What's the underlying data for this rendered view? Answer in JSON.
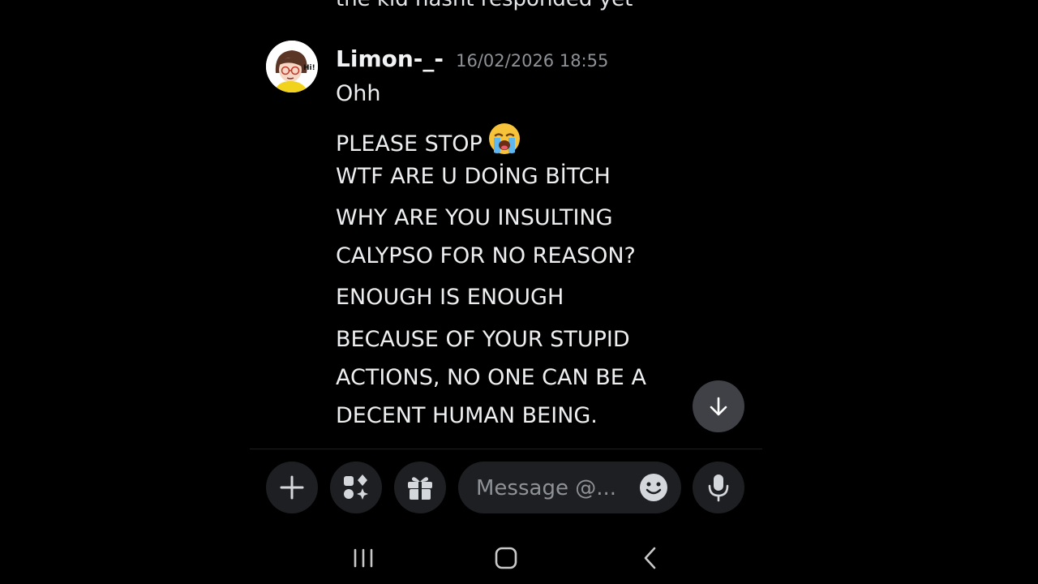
{
  "chat": {
    "previous_message_fragment": "the kid hasnt responded yet"
  },
  "message": {
    "author": "Limon-_-",
    "timestamp": "16/02/2026 18:55",
    "lines": [
      "Ohh",
      "PLEASE STOP",
      "WTF ARE U DOİNG BİTCH",
      "WHY ARE YOU INSULTING",
      "CALYPSO FOR NO REASON?",
      "ENOUGH IS ENOUGH",
      "BECAUSE OF YOUR STUPID",
      "ACTIONS, NO ONE CAN BE A",
      "DECENT HUMAN BEING."
    ],
    "emoji_after_line_2": "loudly-crying-face-emoji"
  },
  "composer": {
    "placeholder": "Message @...",
    "buttons": [
      "plus-icon",
      "apps-icon",
      "gift-icon",
      "emoji-icon",
      "microphone-icon"
    ]
  },
  "navigation": {
    "buttons": [
      "recent-apps-icon",
      "home-icon",
      "back-icon"
    ]
  },
  "colors": {
    "background": "#000000",
    "button_bg": "#1e1f22",
    "scroll_button_bg": "#3f4147",
    "timestamp": "#8e9297",
    "text": "#f2f3f5"
  }
}
